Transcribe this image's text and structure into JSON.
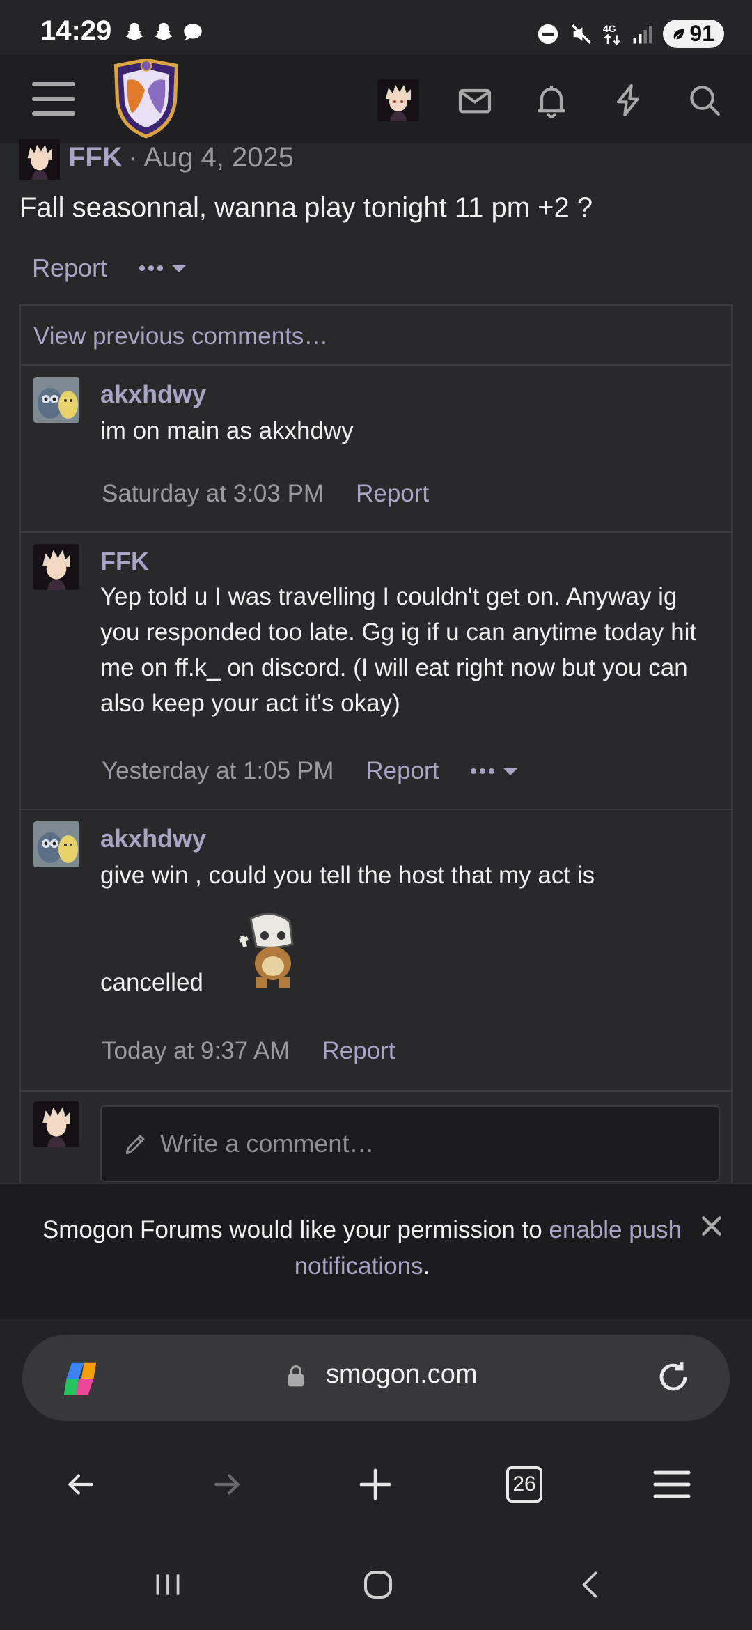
{
  "status_bar": {
    "time": "14:29",
    "battery": "91",
    "network": "4G"
  },
  "header": {
    "menu_icon": "hamburger-icon",
    "logo_icon": "smogon-logo",
    "icons": [
      "avatar",
      "mail-icon",
      "bell-icon",
      "bolt-icon",
      "search-icon"
    ]
  },
  "post": {
    "author": "FFK",
    "date": "· Aug 4, 2025",
    "body": "Fall seasonnal, wanna play tonight 11 pm +2 ?",
    "report": "Report"
  },
  "comments": {
    "view_previous": "View previous comments…",
    "items": [
      {
        "author": "akxhdwy",
        "text": "im on main as akxhdwy",
        "time": "Saturday at 3:03 PM",
        "report": "Report"
      },
      {
        "author": "FFK",
        "text": "Yep told u I was travelling I couldn't get on. Anyway ig you responded too late. Gg ig if u can anytime today hit me on ff.k_ on discord. (I will eat right now but you can also keep your act it's okay)",
        "time": "Yesterday at 1:05 PM",
        "report": "Report"
      },
      {
        "author": "akxhdwy",
        "text": "give win , could you tell the host that my act is",
        "text2": "cancelled",
        "time": "Today at 9:37 AM",
        "report": "Report"
      }
    ],
    "write_placeholder": "Write a comment…"
  },
  "notice": {
    "text_before": "Smogon Forums would like your permission to ",
    "link": "enable push notifications",
    "text_after": "."
  },
  "browser": {
    "url": "smogon.com",
    "tabs_count": "26"
  },
  "colors": {
    "accent": "#a8a4c4",
    "background": "#27272a",
    "header": "#1f1f21"
  }
}
